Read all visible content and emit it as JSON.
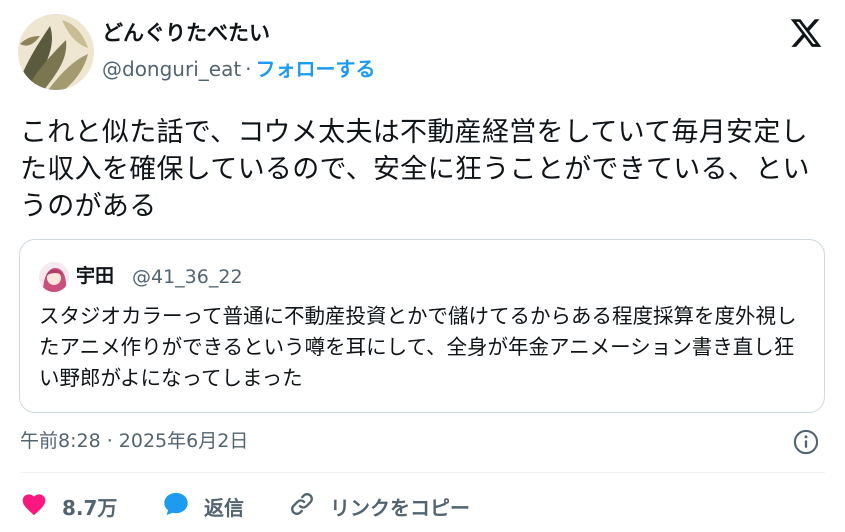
{
  "author": {
    "display_name": "どんぐりたべたい",
    "handle": "@donguri_eat",
    "separator": "·",
    "follow_label": "フォローする"
  },
  "tweet": {
    "text": "これと似た話で、コウメ太夫は不動産経営をしていて毎月安定した収入を確保しているので、安全に狂うことができている、というのがある",
    "timestamp": "午前8:28 · 2025年6月2日"
  },
  "quote": {
    "display_name": "宇田",
    "handle": "@41_36_22",
    "text": "スタジオカラーって普通に不動産投資とかで儲けてるからある程度採算を度外視したアニメ作りができるという噂を耳にして、全身が年金アニメーション書き直し狂い野郎がよになってしまった"
  },
  "actions": {
    "like_count": "8.7万",
    "reply_label": "返信",
    "copy_link_label": "リンクをコピー"
  },
  "icons": {
    "logo": "x-logo-icon",
    "info": "info-icon",
    "like": "heart-icon",
    "reply": "reply-bubble-icon",
    "link": "link-icon"
  },
  "colors": {
    "accent": "#1d9bf0",
    "like": "#f91880",
    "secondary_text": "#536471",
    "border": "#cfd9de"
  }
}
